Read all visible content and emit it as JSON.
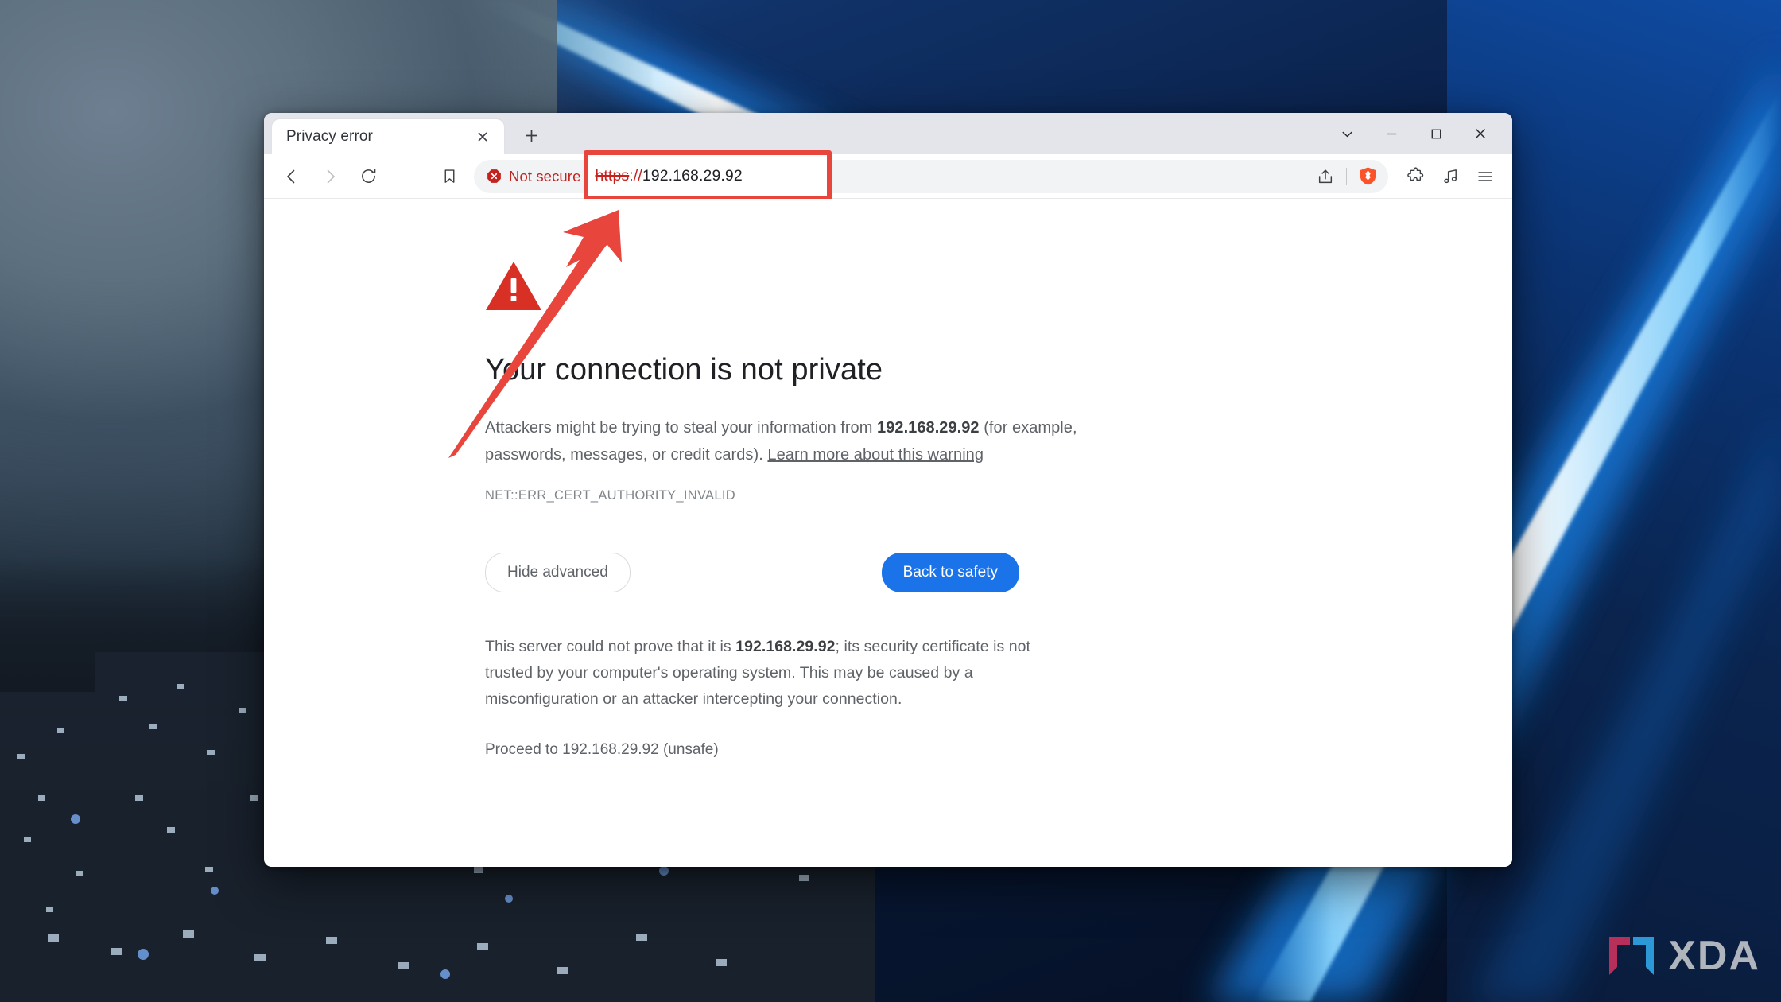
{
  "window": {
    "title_tab": "Privacy error",
    "controls": {
      "tab_search_label": "v",
      "minimize_label": "—",
      "maximize_label": "□",
      "close_label": "✕"
    }
  },
  "tabs": [
    {
      "label": "Privacy error",
      "close_label": "✕"
    }
  ],
  "new_tab_label": "+",
  "toolbar": {
    "back_label": "‹",
    "forward_label": "›",
    "reload_label": "⟳",
    "bookmark_label": "",
    "security_badge": "Not secure",
    "url_scheme": "https",
    "url_separator": "://",
    "url_host": "192.168.29.92",
    "url_full": "https://192.168.29.92"
  },
  "colors": {
    "accent_blue": "#1a73e8",
    "warning_red": "#d93025",
    "annotation_red": "#e8453c",
    "not_secure_red": "#c5221f",
    "brave_orange": "#fb542b",
    "titlebar_grey": "#e3e5ea",
    "omnibox_grey": "#f1f3f4"
  },
  "interstitial": {
    "heading": "Your connection is not private",
    "body_prefix": "Attackers might be trying to steal your information from ",
    "body_host": "192.168.29.92",
    "body_suffix": " (for example, passwords, messages, or credit cards). ",
    "learn_more": "Learn more about this warning",
    "error_code": "NET::ERR_CERT_AUTHORITY_INVALID",
    "hide_advanced_label": "Hide advanced",
    "back_to_safety_label": "Back to safety",
    "advanced_prefix": "This server could not prove that it is ",
    "advanced_host": "192.168.29.92",
    "advanced_suffix": "; its security certificate is not trusted by your computer's operating system. This may be caused by a misconfiguration or an attacker intercepting your connection.",
    "proceed_link": "Proceed to 192.168.29.92 (unsafe)"
  },
  "watermark": {
    "brand": "XDA"
  }
}
